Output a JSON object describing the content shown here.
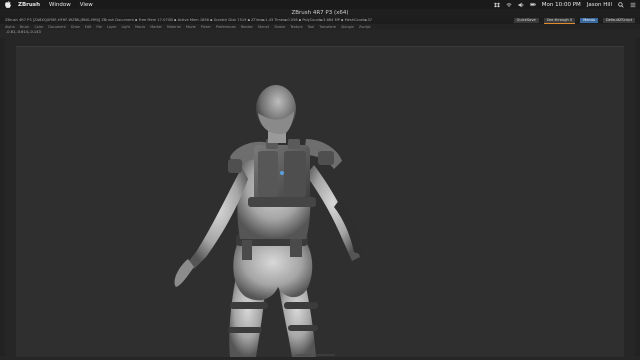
{
  "menubar": {
    "app_name": "ZBrush",
    "menus": [
      "Window",
      "View"
    ],
    "clock": "Mon 10:00 PM",
    "user": "Jason Hill",
    "icons": [
      "apple-icon",
      "dropbox-icon",
      "wifi-icon",
      "volume-icon",
      "battery-icon",
      "search-icon",
      "list-icon"
    ]
  },
  "window": {
    "title": "ZBrush 4R7 P3 (x64)"
  },
  "status": {
    "left_text": "ZBrush 4R7 P3 [ZA8XQJ0Y8F-HFHF-WZBK-JRNG-HMIJ] ZBrush Document   ▪ Free Mem 17.07GB ▪ Active Mem 1856 ▪ Scratch Disk 7519 ▪ ZTime►1.43 Timer►0.058 ▪ PolyCount►3.684 MP ▪ MeshCount►37",
    "quicksave": "QuickSave",
    "see_through": "See-through  0",
    "menus": "Menus",
    "default_script": "DefaultZScript"
  },
  "palettes": [
    "Alpha",
    "Brush",
    "Color",
    "Document",
    "Draw",
    "Edit",
    "File",
    "Layer",
    "Light",
    "Macro",
    "Marker",
    "Material",
    "Movie",
    "Picker",
    "Preferences",
    "Render",
    "Stencil",
    "Stroke",
    "Texture",
    "Tool",
    "Transform",
    "Zplugin",
    "Zscript"
  ],
  "coords": "-0.61,-0.614,-0.143",
  "colors": {
    "background": "#262626",
    "canvas": "#2f2f2f",
    "model_light": "#d4d4d4",
    "model_mid": "#9a9a9a",
    "model_dark": "#3e3e3e"
  }
}
